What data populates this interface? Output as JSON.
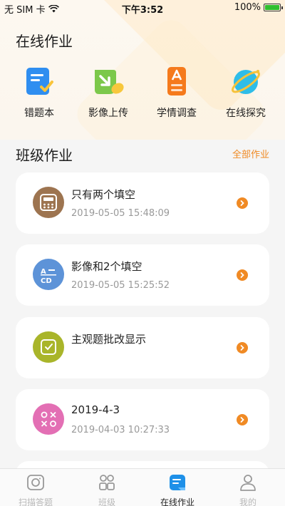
{
  "status_bar": {
    "carrier": "无 SIM 卡",
    "time": "下午3:52",
    "battery": "100%"
  },
  "online": {
    "title": "在线作业",
    "quick_items": [
      {
        "label": "错题本",
        "icon": "wrong-notebook-icon"
      },
      {
        "label": "影像上传",
        "icon": "image-upload-icon"
      },
      {
        "label": "学情调查",
        "icon": "survey-icon"
      },
      {
        "label": "在线探究",
        "icon": "planet-icon"
      }
    ]
  },
  "class": {
    "title": "班级作业",
    "more": "全部作业",
    "cards": [
      {
        "title": "只有两个填空",
        "date": "2019-05-05 15:48:09",
        "icon": "calculator-icon",
        "color": "#9d7450"
      },
      {
        "title": "影像和2个填空",
        "date": "2019-05-05 15:25:52",
        "icon": "abcd-icon",
        "color": "#5d93d8"
      },
      {
        "title": "主观题批改显示",
        "date": "",
        "icon": "subjective-icon",
        "color": "#a9b52a"
      },
      {
        "title": "2019-4-3",
        "date": "2019-04-03 10:27:33",
        "icon": "xo-icon",
        "color": "#e36fb4"
      }
    ]
  },
  "tabbar": {
    "tabs": [
      {
        "label": "扫描答题",
        "icon": "camera-icon",
        "active": false
      },
      {
        "label": "班级",
        "icon": "group-icon",
        "active": false
      },
      {
        "label": "在线作业",
        "icon": "homework-icon",
        "active": true
      },
      {
        "label": "我的",
        "icon": "user-icon",
        "active": false
      }
    ]
  },
  "colors": {
    "accent": "#f08a24",
    "active_tab": "#1e90e8"
  }
}
